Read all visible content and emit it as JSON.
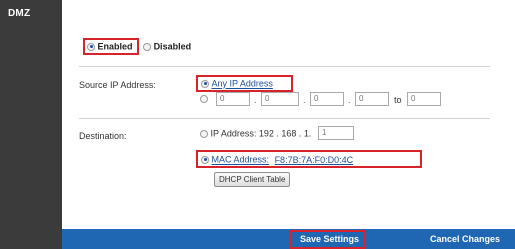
{
  "sidebar": {
    "title": "DMZ"
  },
  "dmz": {
    "enabled_label": "Enabled",
    "disabled_label": "Disabled",
    "selected": "enabled"
  },
  "source": {
    "label": "Source IP Address:",
    "any_ip_label": "Any IP Address",
    "range_octets": [
      "0",
      "0",
      "0",
      "0"
    ],
    "to_label": "to",
    "to_value": "0"
  },
  "destination": {
    "label": "Destination:",
    "ip_label": "IP Address: 192 . 168 . 1.",
    "ip_last_octet": "1",
    "mac_label": "MAC Address:",
    "mac_value": "F8:7B:7A:F0:D0:4C",
    "dhcp_button": "DHCP Client Table"
  },
  "actions": {
    "save": "Save Settings",
    "cancel": "Cancel Changes"
  },
  "colors": {
    "sidebar": "#3b3b3b",
    "bottom_bar": "#1f66b3",
    "highlight": "#d9232b",
    "link_blue": "#1c4f9c"
  }
}
